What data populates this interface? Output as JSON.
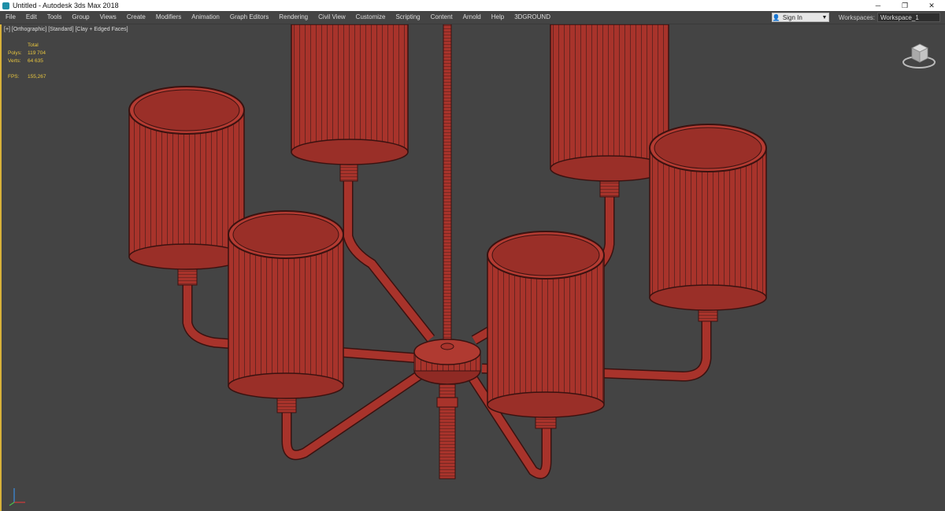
{
  "window": {
    "title": "Untitled - Autodesk 3ds Max 2018",
    "controls": {
      "minimize": "─",
      "maximize": "❐",
      "close": "✕"
    }
  },
  "menubar": {
    "items": [
      "File",
      "Edit",
      "Tools",
      "Group",
      "Views",
      "Create",
      "Modifiers",
      "Animation",
      "Graph Editors",
      "Rendering",
      "Civil View",
      "Customize",
      "Scripting",
      "Content",
      "Arnold",
      "Help",
      "3DGROUND"
    ],
    "sign_in": "Sign In",
    "workspaces_label": "Workspaces:",
    "workspace_value": "Workspace_1"
  },
  "viewport": {
    "label": "[+] [Orthographic] [Standard] [Clay + Edged Faces]",
    "stats": {
      "header": "Total",
      "polys_label": "Polys:",
      "polys_value": "119 704",
      "verts_label": "Verts:",
      "verts_value": "64 635",
      "fps_label": "FPS:",
      "fps_value": "155,267"
    }
  },
  "colors": {
    "viewport_bg": "#444444",
    "mesh_fill": "#a8332b",
    "mesh_wire": "#4a1412",
    "stats_text": "#e7c53f",
    "active_border": "#d8b13a"
  },
  "icons": {
    "app": "3ds-max-icon",
    "viewcube": "viewcube-icon",
    "axis": "axis-tripod-icon",
    "user": "user-icon",
    "dropdown": "chevron-down-icon"
  }
}
